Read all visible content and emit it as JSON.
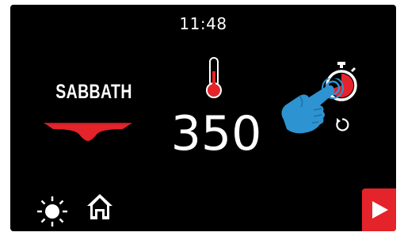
{
  "status_bar": {
    "time": "11:48"
  },
  "mode": {
    "label": "SABBATH",
    "icon": "pan-icon"
  },
  "temperature": {
    "value": "350",
    "icon": "thermometer-icon"
  },
  "timer": {
    "icon": "timer-icon",
    "reset_icon": "reset-icon"
  },
  "gesture_hint": {
    "icon": "pointing-hand-icon"
  },
  "bottom_bar": {
    "items": [
      {
        "icon": "light-icon"
      },
      {
        "icon": "home-icon"
      },
      {
        "icon": "start-icon"
      }
    ]
  },
  "colors": {
    "background": "#000000",
    "accent_red": "#e5232a",
    "hand_blue": "#2e93d1",
    "text": "#ffffff"
  }
}
